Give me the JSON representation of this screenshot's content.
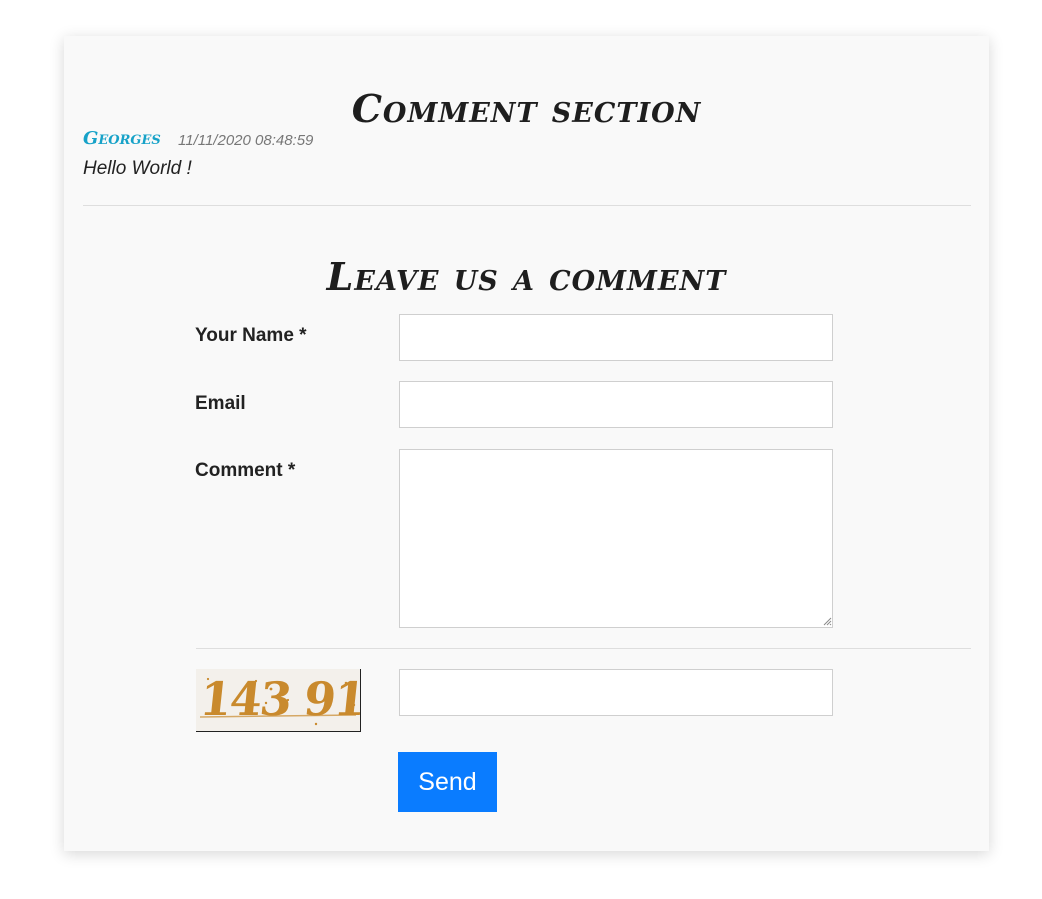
{
  "comment_section": {
    "title": "Comment section",
    "comments": [
      {
        "author": "Georges",
        "date": "11/11/2020 08:48:59",
        "text": "Hello World !"
      }
    ]
  },
  "form": {
    "title": "Leave us a comment",
    "name_label": "Your Name *",
    "name_value": "",
    "email_label": "Email",
    "email_value": "",
    "comment_label": "Comment *",
    "comment_value": "",
    "captcha_text": "143 91",
    "captcha_value": "",
    "send_label": "Send"
  },
  "colors": {
    "accent": "#0a7cff",
    "author": "#17a2c8",
    "captcha": "#c98a2d",
    "card_background": "#f9f9f9"
  }
}
